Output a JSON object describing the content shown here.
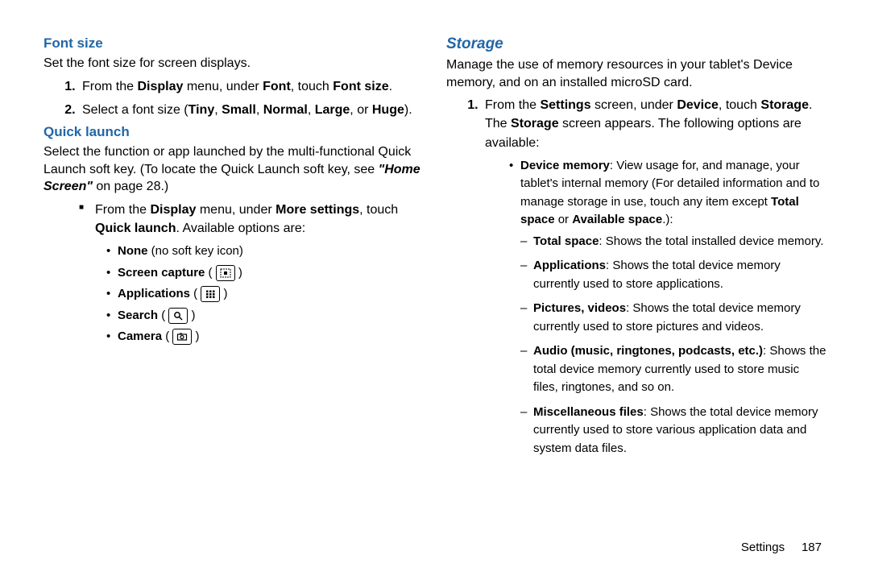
{
  "left": {
    "heading1": "Font size",
    "intro1": "Set the font size for screen displays.",
    "step1a_pre": "From the ",
    "step1a_m1": "Display",
    "step1a_mid": " menu, under ",
    "step1a_m2": "Font",
    "step1a_mid2": ", touch ",
    "step1a_m3": "Font size",
    "step1a_end": ".",
    "step1b_pre": "Select a font size (",
    "step1b_o1": "Tiny",
    "step1b_sep": ", ",
    "step1b_o2": "Small",
    "step1b_o3": "Normal",
    "step1b_o4": "Large",
    "step1b_or": ", or ",
    "step1b_o5": "Huge",
    "step1b_end": ").",
    "heading2": "Quick launch",
    "intro2_a": "Select the function or app launched by the multi-functional Quick Launch soft key. (To locate the Quick Launch soft key, see ",
    "intro2_ref": "\"Home Screen\"",
    "intro2_b": " on page 28.)",
    "sq_pre": "From the ",
    "sq_m1": "Display",
    "sq_mid": " menu, under ",
    "sq_m2": "More settings",
    "sq_mid2": ", touch ",
    "sq_m3": "Quick launch",
    "sq_end": ". Available options are:",
    "opt_none_b": "None",
    "opt_none_n": " (no soft key icon)",
    "opt_sc": "Screen capture",
    "opt_apps": "Applications",
    "opt_search": "Search",
    "opt_camera": "Camera"
  },
  "right": {
    "heading": "Storage",
    "intro": "Manage the use of memory resources in your tablet's Device memory, and on an installed microSD card.",
    "step1_pre": "From the ",
    "step1_m1": "Settings",
    "step1_mid": " screen, under ",
    "step1_m2": "Device",
    "step1_mid2": ", touch ",
    "step1_m3": "Storage",
    "step1_dot": ". The ",
    "step1_m4": "Storage",
    "step1_end": " screen appears. The following options are available:",
    "dm_b": "Device memory",
    "dm_t1": ": View usage for, and manage, your tablet's internal memory (For detailed information and to manage storage in use, touch any item except ",
    "dm_b2": "Total space",
    "dm_or": " or ",
    "dm_b3": "Available space",
    "dm_end": ".):",
    "ts_b": "Total space",
    "ts_t": ": Shows the total installed device memory.",
    "ap_b": "Applications",
    "ap_t": ": Shows the total device memory currently used to store applications.",
    "pv_b": "Pictures, videos",
    "pv_t": ": Shows the total device memory currently used to store pictures and videos.",
    "au_b": "Audio (music, ringtones, podcasts, etc.)",
    "au_t": ": Shows the total device memory currently used to store music files, ringtones, and so on.",
    "mf_b": "Miscellaneous files",
    "mf_t": ": Shows the total device memory currently used to store various application data and system data files."
  },
  "footer": {
    "section": "Settings",
    "page": "187"
  }
}
